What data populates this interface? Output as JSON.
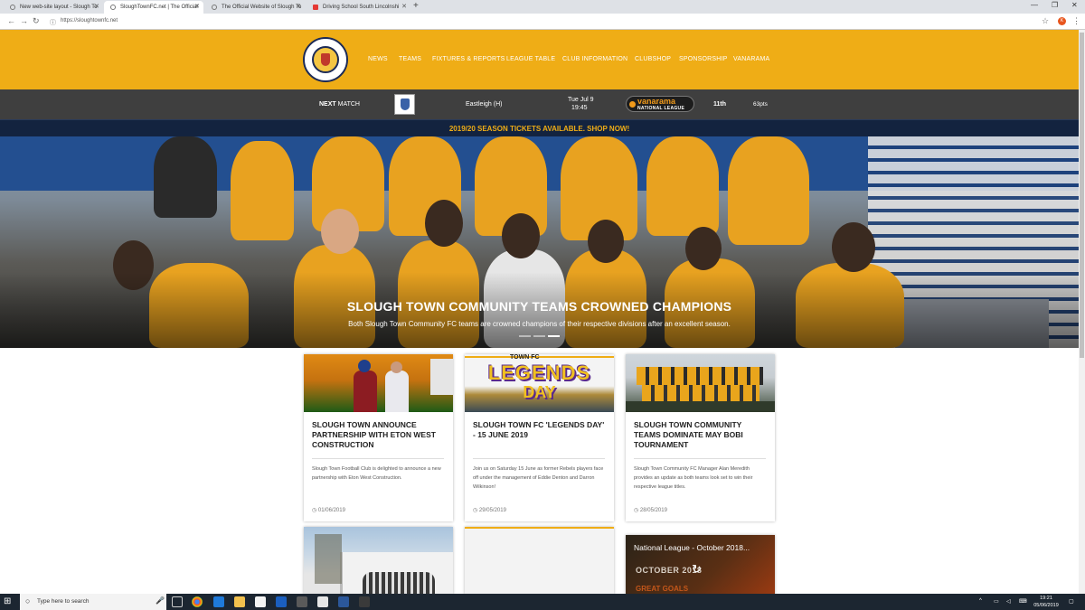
{
  "browser": {
    "tabs": [
      {
        "label": "New web-site layout - Slough To"
      },
      {
        "label": "SloughTownFC.net | The Official"
      },
      {
        "label": "The Official Website of Slough To"
      },
      {
        "label": "Driving School South Lincolnshi"
      }
    ],
    "url": "https://sloughtownfc.net",
    "profile_initial": "K"
  },
  "site": {
    "nav": [
      "NEWS",
      "TEAMS",
      "FIXTURES & REPORTS",
      "LEAGUE TABLE",
      "CLUB INFORMATION",
      "CLUBSHOP",
      "SPONSORSHIP",
      "VANARAMA"
    ],
    "crest_text": "SLOUGH TOWN F.C."
  },
  "match": {
    "label_bold": "NEXT",
    "label_rest": " MATCH",
    "opponent": "Eastleigh (H)",
    "date": "Tue Jul 9",
    "time": "19:45",
    "league_logo_main": "vanarama",
    "league_logo_sub": "NATIONAL LEAGUE",
    "position": "11th",
    "points": "63pts"
  },
  "ticket_banner": "2019/20 SEASON TICKETS AVAILABLE. SHOP NOW!",
  "hero": {
    "title": "SLOUGH TOWN COMMUNITY TEAMS CROWNED CHAMPIONS",
    "subtitle": "Both Slough Town Community FC teams are crowned champions of their respective divisions after an excellent season."
  },
  "news": [
    {
      "title": "SLOUGH TOWN ANNOUNCE PARTNERSHIP WITH ETON WEST CONSTRUCTION",
      "body": "Slough Town Football Club is delighted to announce a new partnership with Eton West Construction.",
      "date": "01/06/2019"
    },
    {
      "title": "SLOUGH TOWN FC 'LEGENDS DAY' - 15 JUNE 2019",
      "body": "Join us on Saturday 15 June as former Rebels players face off under the management of Eddie Denton and Darron Wilkinson!",
      "date": "29/05/2019",
      "image_text_top": "TOWN FC",
      "image_text_main": "LEGENDS",
      "image_text_sub": "DAY"
    },
    {
      "title": "SLOUGH TOWN COMMUNITY TEAMS DOMINATE MAY BOBI TOURNAMENT",
      "body": "Slough Town Community FC Manager Alan Meredith provides an update as both teams look set to win their respective league titles.",
      "date": "28/05/2019"
    }
  ],
  "video_card": {
    "title": "National League - October 2018...",
    "overlay_text": "OCTOBER 2018",
    "overlay_sub": "GREAT GOALS"
  },
  "taskbar": {
    "search_placeholder": "Type here to search",
    "time": "19:21",
    "date": "05/06/2019"
  },
  "colors": {
    "brand_amber": "#efad16",
    "brand_navy": "#13233f",
    "matchbar": "#3f3f3f"
  }
}
